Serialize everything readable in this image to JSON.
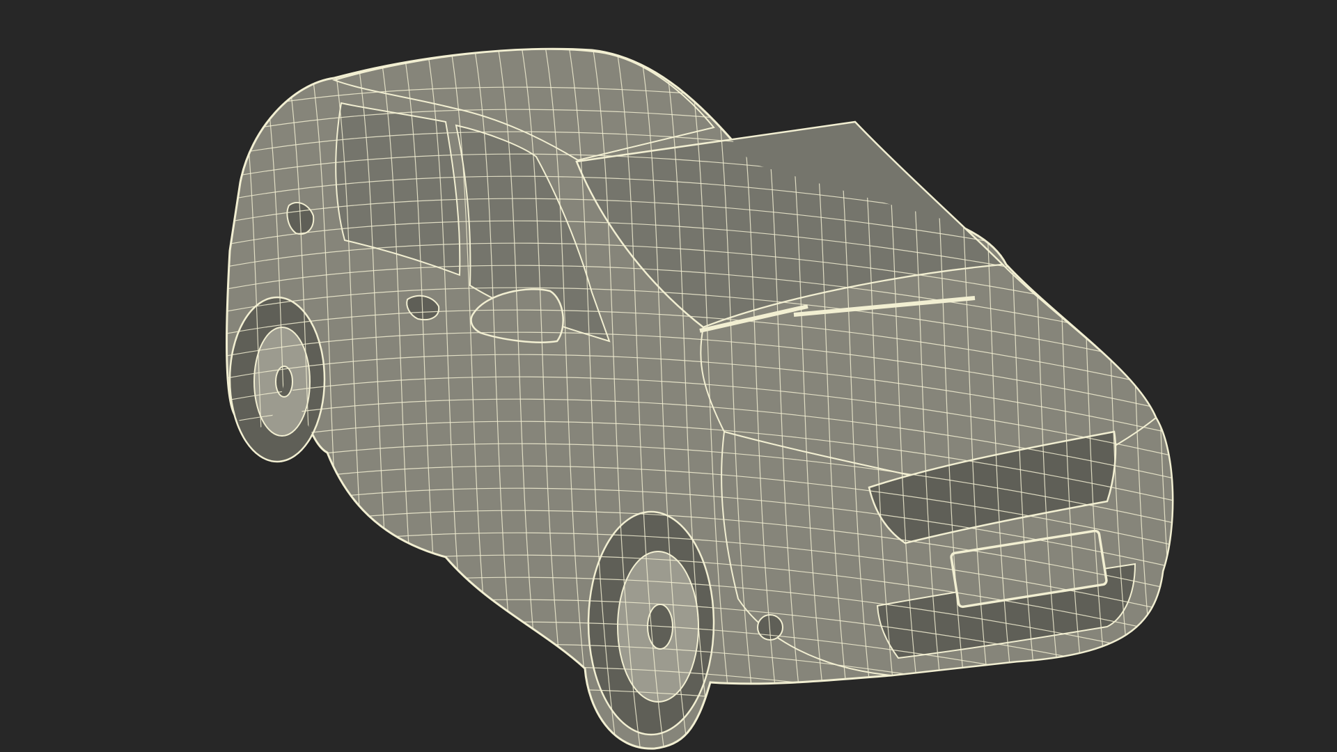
{
  "colors": {
    "background": "#272727",
    "body_fill": "#86857a",
    "glass_fill": "#75756c",
    "dark_fill": "#5f5f57",
    "wire": "#f2efd2",
    "rim_fill": "#9c9b8f"
  }
}
